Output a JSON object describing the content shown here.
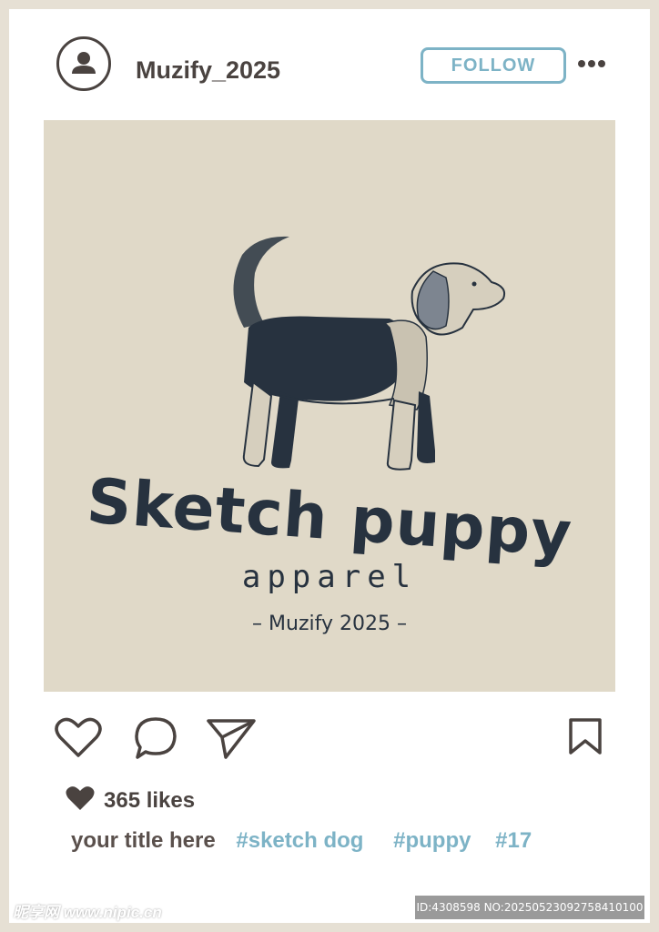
{
  "header": {
    "avatar_icon": "user-avatar-icon",
    "username": "Muzify_2025",
    "follow_label": "FOLLOW",
    "more_icon": "more-dots-icon"
  },
  "post": {
    "image_description_icon": "beagle-sketch",
    "brand_title": "Sketch puppy",
    "brand_subtitle": "apparel",
    "brand_credit": "– Muzify 2025 –",
    "background_color": "#e0d9c8"
  },
  "actions": {
    "like_icon": "heart-outline-icon",
    "comment_icon": "comment-icon",
    "share_icon": "send-icon",
    "save_icon": "bookmark-icon"
  },
  "likes": {
    "icon": "heart-filled-icon",
    "label": "365 likes"
  },
  "caption": {
    "title": "your title here",
    "tags": [
      "#sketch dog",
      "#puppy",
      "#17"
    ]
  },
  "watermark": {
    "left": "昵享网 www.nipic.cn",
    "right": "ID:4308598 NO:20250523092758410100"
  },
  "colors": {
    "accent": "#7db3c6",
    "text_dark": "#4a4340",
    "frame": "#e6e0d4",
    "ink": "#27323f"
  }
}
